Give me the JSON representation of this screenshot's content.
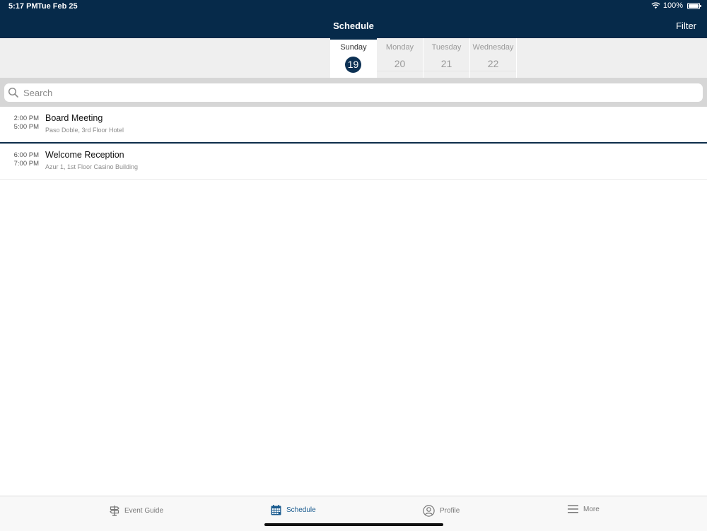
{
  "status": {
    "time": "5:17 PM",
    "date": "Tue Feb 25",
    "battery": "100%"
  },
  "nav": {
    "title": "Schedule",
    "filter_label": "Filter"
  },
  "days": [
    {
      "name": "Sunday",
      "number": "19",
      "active": true
    },
    {
      "name": "Monday",
      "number": "20",
      "active": false
    },
    {
      "name": "Tuesday",
      "number": "21",
      "active": false
    },
    {
      "name": "Wednesday",
      "number": "22",
      "active": false
    }
  ],
  "search": {
    "placeholder": "Search",
    "value": ""
  },
  "events": [
    {
      "start": "2:00 PM",
      "end": "5:00 PM",
      "title": "Board Meeting",
      "location": "Paso Doble, 3rd Floor Hotel"
    },
    {
      "start": "6:00 PM",
      "end": "7:00 PM",
      "title": "Welcome Reception",
      "location": "Azur 1, 1st Floor Casino Building"
    }
  ],
  "tabs": [
    {
      "label": "Event Guide",
      "icon": "signpost-icon",
      "active": false
    },
    {
      "label": "Schedule",
      "icon": "calendar-icon",
      "active": true
    },
    {
      "label": "Profile",
      "icon": "user-circle-icon",
      "active": false
    },
    {
      "label": "More",
      "icon": "menu-icon",
      "active": false
    }
  ],
  "colors": {
    "navbar": "#062a4a",
    "accent": "#1a5b8f",
    "active_day": "#0d3154"
  }
}
